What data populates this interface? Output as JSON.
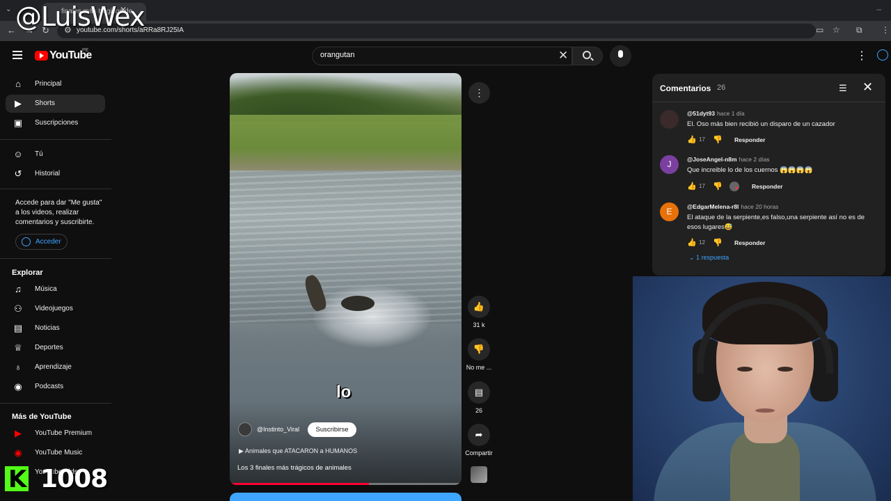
{
  "watermark": "@LuisWex",
  "browser": {
    "tab_title": "finales más trágicos de",
    "url": "youtube.com/shorts/aRRa8RJ25IA"
  },
  "youtube": {
    "logo_text": "YouTube",
    "region": "PE",
    "search_value": "orangutan"
  },
  "sidebar": {
    "main": [
      {
        "label": "Principal",
        "icon": "home-icon"
      },
      {
        "label": "Shorts",
        "icon": "shorts-icon",
        "active": true
      },
      {
        "label": "Suscripciones",
        "icon": "subscriptions-icon"
      }
    ],
    "you": [
      {
        "label": "Tú",
        "icon": "you-icon"
      },
      {
        "label": "Historial",
        "icon": "history-icon"
      }
    ],
    "signin_text": "Accede para dar \"Me gusta\" a los videos, realizar comentarios y suscribirte.",
    "signin_button": "Acceder",
    "explore_heading": "Explorar",
    "explore": [
      {
        "label": "Música",
        "icon": "music-icon"
      },
      {
        "label": "Videojuegos",
        "icon": "gaming-icon"
      },
      {
        "label": "Noticias",
        "icon": "news-icon"
      },
      {
        "label": "Deportes",
        "icon": "trophy-icon"
      },
      {
        "label": "Aprendizaje",
        "icon": "bulb-icon"
      },
      {
        "label": "Podcasts",
        "icon": "podcast-icon"
      }
    ],
    "more_heading": "Más de YouTube",
    "more": [
      {
        "label": "YouTube Premium",
        "icon": "youtube-premium-icon"
      },
      {
        "label": "YouTube Music",
        "icon": "youtube-music-icon"
      },
      {
        "label": "YouTube Kids",
        "icon": "youtube-kids-icon"
      }
    ]
  },
  "short": {
    "caption": "lo",
    "channel": "@Instinto_Viral",
    "subscribe": "Suscribirse",
    "playlist": "Animales que ATACARON a HUMANOS",
    "title": "Los 3 finales más trágicos de animales",
    "progress": 0.6,
    "actions": {
      "likes": "31 k",
      "dislike": "No me ...",
      "comments": "26",
      "share": "Compartir"
    }
  },
  "comments": {
    "title": "Comentarios",
    "count": "26",
    "items": [
      {
        "avatar": "",
        "avatar_color": "#3b2a2a",
        "user": "@51dyt93",
        "time": "hace 1 día",
        "text": "El. Oso más bien recibió un disparo de un cazador",
        "likes": "17",
        "reply": "Responder"
      },
      {
        "avatar": "J",
        "avatar_color": "#7b3fa0",
        "user": "@JoseAngel-n8m",
        "time": "hace 2 días",
        "text": "Que increible lo de los cuernos 😱😱😱😱",
        "likes": "17",
        "reply": "Responder",
        "creator_heart": true
      },
      {
        "avatar": "E",
        "avatar_color": "#e8710a",
        "user": "@EdgarMelena-r8l",
        "time": "hace 20 horas",
        "text": "El ataque de la serpiente,es falso,una serpiente así no es de esos lugares😅",
        "likes": "12",
        "reply": "Responder",
        "replies": "1 respuesta"
      }
    ]
  },
  "overlay": {
    "viewer_count": "1008"
  }
}
